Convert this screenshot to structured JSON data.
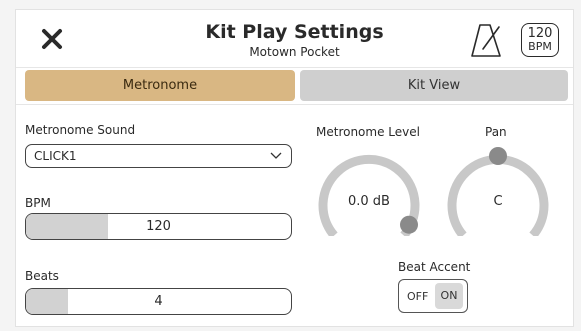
{
  "header": {
    "title": "Kit Play Settings",
    "subtitle": "Motown Pocket",
    "bpm_badge": {
      "value": "120",
      "unit": "BPM"
    },
    "icons": [
      "close-icon",
      "metronome-icon"
    ]
  },
  "tabs": [
    {
      "label": "Metronome",
      "active": true
    },
    {
      "label": "Kit View",
      "active": false
    }
  ],
  "metronome_sound": {
    "label": "Metronome Sound",
    "value": "CLICK1"
  },
  "bpm": {
    "label": "BPM",
    "value": "120",
    "fill_fraction": 0.31
  },
  "beats": {
    "label": "Beats",
    "value": "4",
    "fill_fraction": 0.16
  },
  "metronome_level": {
    "label": "Metronome Level",
    "value": "0.0 dB",
    "knob_position": 1.0
  },
  "pan": {
    "label": "Pan",
    "value": "C",
    "knob_position": 0.5
  },
  "beat_accent": {
    "label": "Beat Accent",
    "off_label": "OFF",
    "on_label": "ON",
    "state": "ON"
  },
  "colors": {
    "active_tab": "#d9b783",
    "inactive_tab": "#cfcfcf",
    "knob_track": "#c8c8c8",
    "knob_handle": "#8a8a8a"
  }
}
